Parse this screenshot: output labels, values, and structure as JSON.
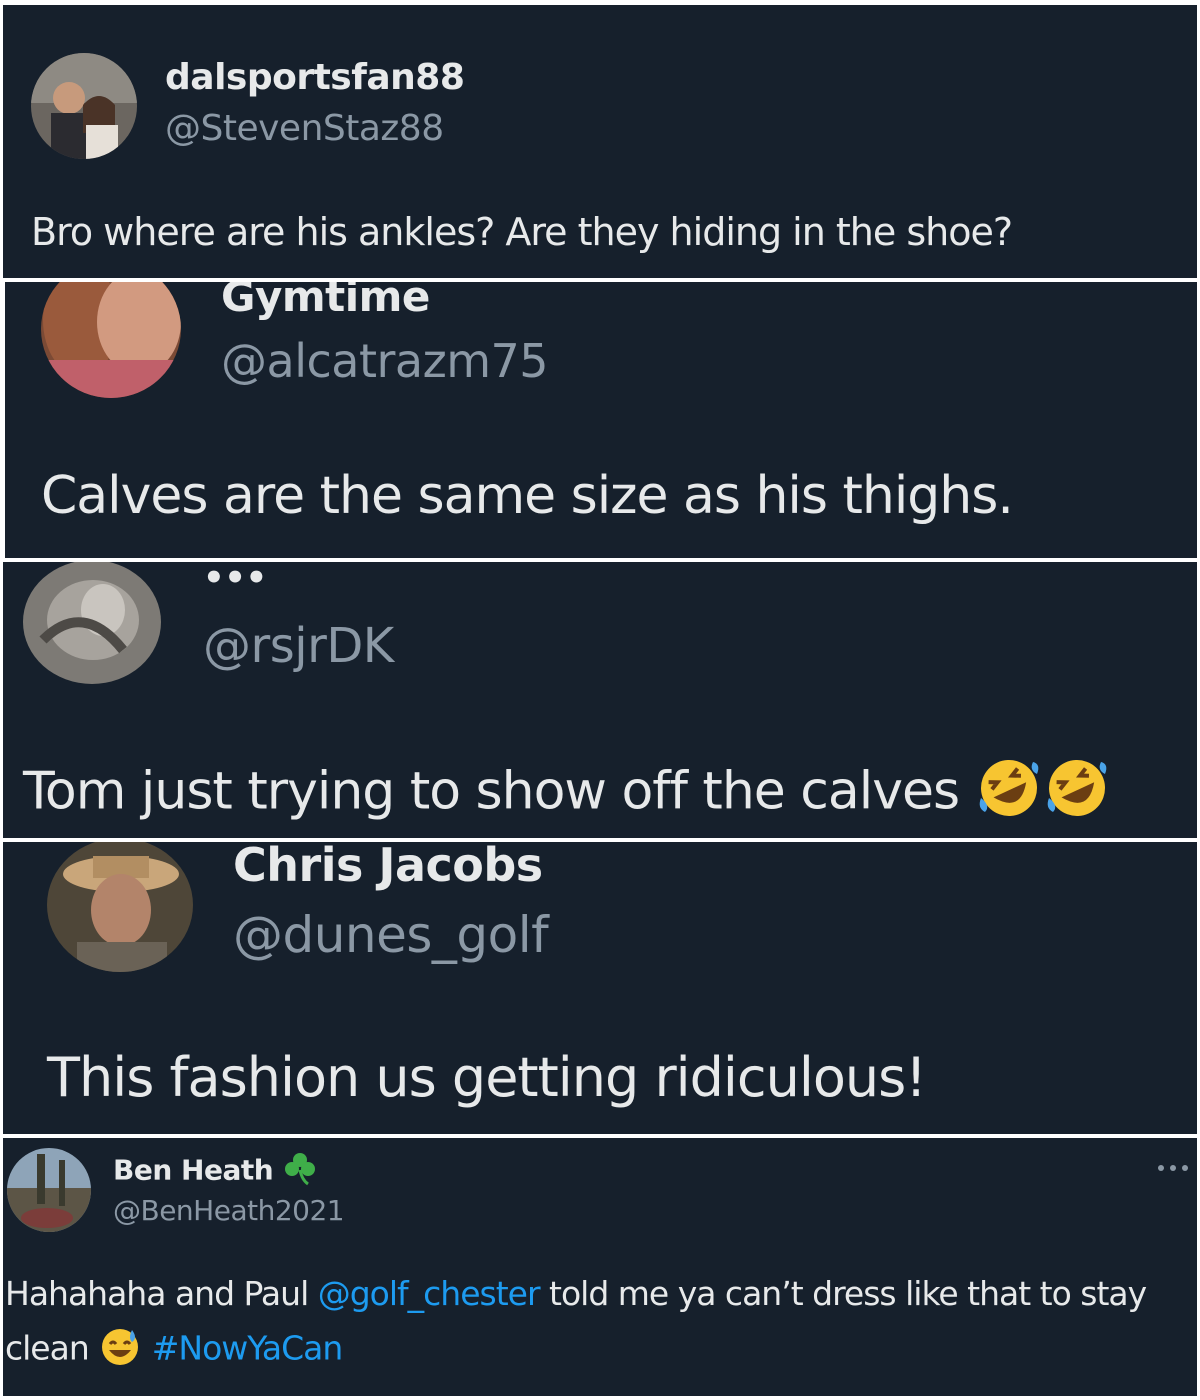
{
  "colors": {
    "background": "#16202c",
    "text_primary": "#e7e9ea",
    "text_secondary": "#8b98a5",
    "link": "#1d9bf0",
    "divider": "#ffffff"
  },
  "tweets": [
    {
      "name": "dalsportsfan88",
      "handle": "@StevenStaz88",
      "text": "Bro where are his ankles? Are they hiding in the shoe?"
    },
    {
      "name": "Gymtime",
      "handle": "@alcatrazm75",
      "text": "Calves are the same size as his thighs."
    },
    {
      "name": "•••",
      "handle": "@rsjrDK",
      "text": "Tom just trying to show off the calves",
      "emojis": [
        "rolling-on-floor-laughing-icon",
        "rolling-on-floor-laughing-icon"
      ]
    },
    {
      "name": "Chris Jacobs",
      "handle": "@dunes_golf",
      "text": "This fashion us getting ridiculous!"
    },
    {
      "name": "Ben Heath",
      "name_emoji": "shamrock-icon",
      "handle": "@BenHeath2021",
      "more_icon": "more-icon",
      "text_part1": "Hahahaha and Paul ",
      "mention": "@golf_chester",
      "text_part2": " told me ya can’t dress like that to stay",
      "text_line2": "clean",
      "line2_emoji": "grinning-sweat-icon",
      "hashtag": "#NowYaCan"
    }
  ]
}
